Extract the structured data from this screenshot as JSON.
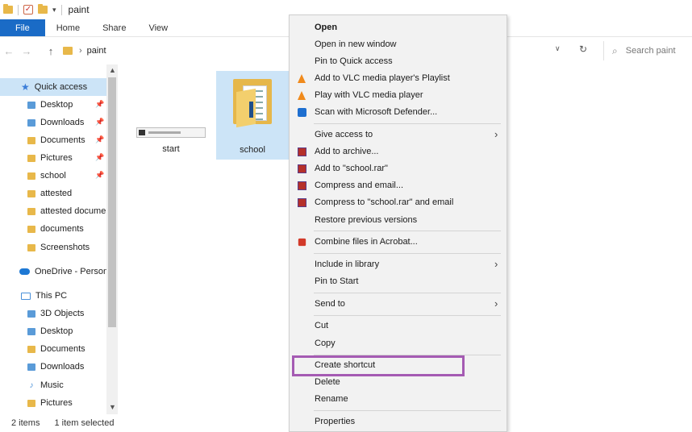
{
  "window": {
    "title": "paint"
  },
  "ribbon": {
    "tabs": [
      "File",
      "Home",
      "Share",
      "View"
    ]
  },
  "address": {
    "path": "paint",
    "search_placeholder": "Search paint"
  },
  "nav": {
    "quick_access": "Quick access",
    "items": [
      {
        "label": "Desktop",
        "icon": "desktop-folder-icon",
        "pinned": true
      },
      {
        "label": "Downloads",
        "icon": "downloads-folder-icon",
        "pinned": true
      },
      {
        "label": "Documents",
        "icon": "documents-folder-icon",
        "pinned": true
      },
      {
        "label": "Pictures",
        "icon": "pictures-folder-icon",
        "pinned": true
      },
      {
        "label": "school",
        "icon": "folder-icon",
        "pinned": true
      },
      {
        "label": "attested",
        "icon": "folder-icon",
        "pinned": false
      },
      {
        "label": "attested docume",
        "icon": "folder-icon",
        "pinned": false
      },
      {
        "label": "documents",
        "icon": "folder-icon",
        "pinned": false
      },
      {
        "label": "Screenshots",
        "icon": "folder-icon",
        "pinned": false
      }
    ],
    "onedrive": "OneDrive - Person",
    "this_pc": "This PC",
    "pc_items": [
      "3D Objects",
      "Desktop",
      "Documents",
      "Downloads",
      "Music",
      "Pictures"
    ]
  },
  "content": {
    "items": [
      {
        "name": "start",
        "type": "image"
      },
      {
        "name": "school",
        "type": "folder",
        "selected": true
      }
    ]
  },
  "status": {
    "count": "2 items",
    "selected": "1 item selected"
  },
  "context_menu": {
    "open": "Open",
    "open_new_window": "Open in new window",
    "pin_quick_access": "Pin to Quick access",
    "vlc_playlist": "Add to VLC media player's Playlist",
    "vlc_play": "Play with VLC media player",
    "defender": "Scan with Microsoft Defender...",
    "give_access": "Give access to",
    "add_archive": "Add to archive...",
    "add_rar": "Add to \"school.rar\"",
    "compress_email": "Compress and email...",
    "compress_rar_email": "Compress to \"school.rar\" and email",
    "restore_versions": "Restore previous versions",
    "combine_acrobat": "Combine files in Acrobat...",
    "include_library": "Include in library",
    "pin_start": "Pin to Start",
    "send_to": "Send to",
    "cut": "Cut",
    "copy": "Copy",
    "create_shortcut": "Create shortcut",
    "delete": "Delete",
    "rename": "Rename",
    "properties": "Properties"
  },
  "colors": {
    "accent": "#1a6bc6",
    "selection": "#cce4f7",
    "highlight_border": "#a55bb3"
  }
}
